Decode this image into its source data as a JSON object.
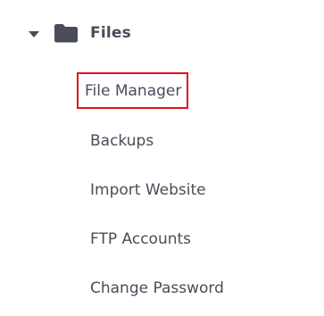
{
  "section": {
    "title": "Files",
    "icon": "folder-icon",
    "expanded": true,
    "caret_icon": "caret-down-icon"
  },
  "menu": {
    "items": [
      {
        "label": "File Manager",
        "highlighted": true
      },
      {
        "label": "Backups",
        "highlighted": false
      },
      {
        "label": "Import Website",
        "highlighted": false
      },
      {
        "label": "FTP Accounts",
        "highlighted": false
      },
      {
        "label": "Change Password",
        "highlighted": false
      }
    ]
  },
  "colors": {
    "text": "#4a4c5a",
    "highlight_border": "#e0121a",
    "background": "#ffffff"
  }
}
